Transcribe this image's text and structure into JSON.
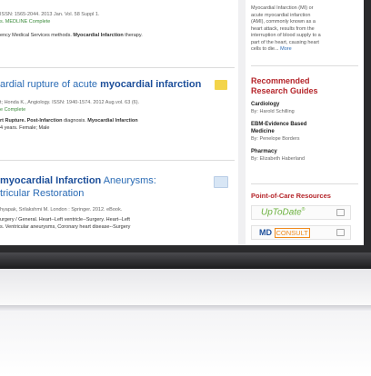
{
  "results": [
    {
      "meta1": "ISSN: 1565-2044. 2013 Jan. Vol. 58 Suppl 1.",
      "meta2": "s. MEDLINE Complete",
      "snippet_pre": "ency Medical Services methods. ",
      "snippet_bold": "Myocardial Infarction",
      "snippet_post": " therapy."
    },
    {
      "title_pre": "ardial rupture of acute ",
      "title_bold": "myocardial infarction",
      "meta1": "t; Honda K., Angiology. ISSN: 1940-1574. 2012 Aug.vol. 63 (6).",
      "meta2": "e Complete",
      "snippet_pre": "rt Rupture. Post-Infarction",
      "snippet_mid": " diagnosis. ",
      "snippet_bold": "Myocardial Infarction",
      "snippet2": "4 years. Female; Male"
    },
    {
      "title_bold": "myocardial Infarction",
      "title_post": " Aneurysms:",
      "title_line2": "tricular Restoration",
      "meta1": "hyapak, Srilakshmi M. London : Springer. 2012. eBook.",
      "snippet1": "urgery / General. Heart--Left ventricle--Surgery. Heart--Left",
      "snippet2": "s. Ventricular aneurysms, Coronary heart disease--Surgery"
    }
  ],
  "sidebar": {
    "intro_lines": [
      "Myocardial Infarction (MI) or",
      "acute myocardial infarction",
      "(AMI), commonly known as a",
      "heart attack, results from the",
      "interruption of blood supply to a",
      "part of the heart, causing heart",
      "cells to die..."
    ],
    "more_link": "More",
    "guides_heading_line1": "Recommended",
    "guides_heading_line2": "Research Guides",
    "guides": [
      {
        "name": "Cardiology",
        "by": "By: Harold Schilling"
      },
      {
        "name": "EBM-Evidence Based",
        "name2": "Medicine",
        "by": "By: Penelope Borders"
      },
      {
        "name": "Pharmacy",
        "by": "By: Elizabeth Haberland"
      }
    ],
    "poc_heading": "Point-of-Care Resources",
    "poc": [
      {
        "label": "UpToDate",
        "mark": "®"
      },
      {
        "label_a": "MD",
        "label_b": "CONSULT"
      }
    ]
  },
  "colors": {
    "link": "#2a6bb5",
    "heading_red": "#b5262b",
    "uptodate_green": "#6bb13e",
    "consult_orange": "#f08a1c",
    "folder_yellow": "#f3d44a"
  }
}
